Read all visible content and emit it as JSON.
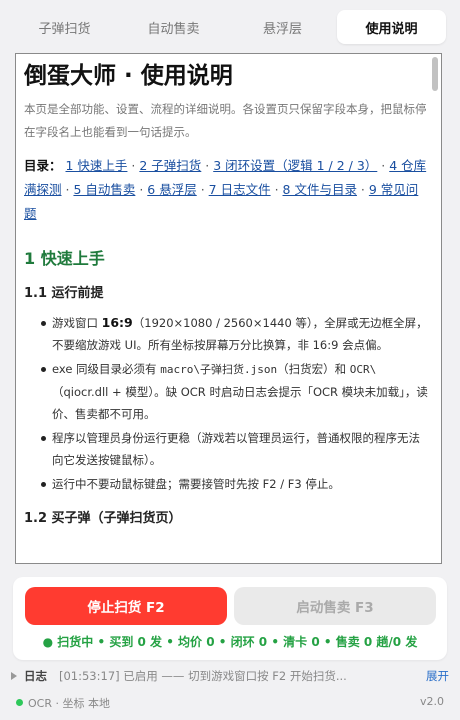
{
  "tabs": [
    {
      "label": "子弹扫货",
      "active": false
    },
    {
      "label": "自动售卖",
      "active": false
    },
    {
      "label": "悬浮层",
      "active": false
    },
    {
      "label": "使用说明",
      "active": true
    }
  ],
  "doc": {
    "title": "倒蛋大师 · 使用说明",
    "intro": "本页是全部功能、设置、流程的详细说明。各设置页只保留字段本身，把鼠标停在字段名上也能看到一句话提示。",
    "toc_label": "目录：",
    "toc": [
      "1 快速上手",
      "2 子弹扫货",
      "3 闭环设置（逻辑 1 / 2 / 3）",
      "4 仓库满探测",
      "5 自动售卖",
      "6 悬浮层",
      "7 日志文件",
      "8 文件与目录",
      "9 常见问题"
    ],
    "toc_sep": " · ",
    "section1_title": "1 快速上手",
    "sub1_title": "1.1 运行前提",
    "b1_pre": "游戏窗口 ",
    "b1_bold": "16:9",
    "b1_post": "（1920×1080 / 2560×1440 等），全屏或无边框全屏，不要缩放游戏 UI。所有坐标按屏幕万分比换算，非 16:9 会点偏。",
    "b2_pre": "exe 同级目录必须有 ",
    "b2_code1": "macro\\子弹扫货.json",
    "b2_mid": "（扫货宏）和 ",
    "b2_code2": "OCR\\",
    "b2_post": "（qiocr.dll + 模型）。缺 OCR 时启动日志会提示「OCR 模块未加载」，读价、售卖都不可用。",
    "b3": "程序以管理员身份运行更稳（游戏若以管理员运行，普通权限的程序无法向它发送按键鼠标）。",
    "b4": "运行中不要动鼠标键盘；需要接管时先按 F2 / F3 停止。",
    "sub2_title": "1.2 买子弹（子弹扫货页）"
  },
  "actions": {
    "stop_label": "停止扫货  F2",
    "start_label": "启动售卖  F3"
  },
  "status_text": "● 扫货中 • 买到 0 发 • 均价 0 • 闭环 0 • 清卡 0 • 售卖 0 趟/0 发",
  "log": {
    "label": "日志",
    "text": "[01:53:17] 已启用 —— 切到游戏窗口按 F2 开始扫货...",
    "expand_label": "展开"
  },
  "footer": {
    "text": "OCR · 坐标 本地",
    "version": "v2.0"
  },
  "colors": {
    "accent_red": "#ff3b30",
    "status_green": "#25a244",
    "heading_green": "#1f7a3c",
    "link_blue": "#1a4fa0"
  }
}
